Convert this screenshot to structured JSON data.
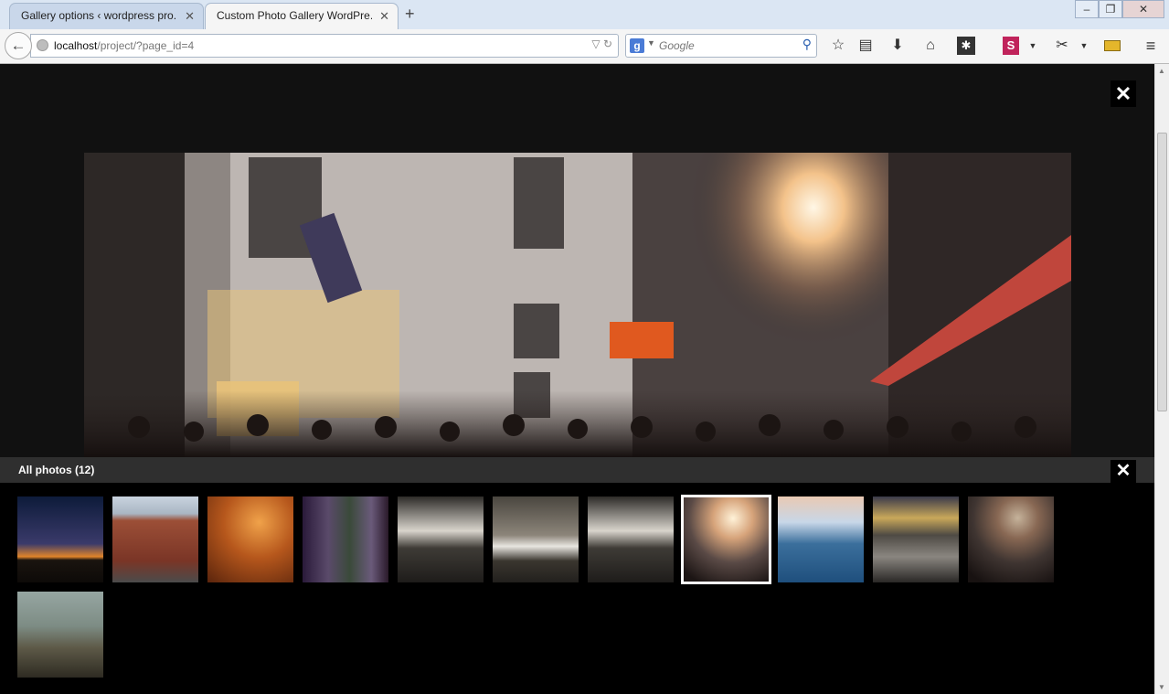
{
  "browser": {
    "tabs": [
      {
        "title": "Gallery options ‹ wordpress pro...",
        "active": false,
        "close": "✕"
      },
      {
        "title": "Custom Photo Gallery WordPre...",
        "active": true,
        "close": "✕"
      }
    ],
    "new_tab": "+",
    "window_controls": {
      "minimize": "‒",
      "restore": "❐",
      "close": "✕"
    },
    "back": "←",
    "url": {
      "host": "localhost",
      "path": "/project/?page_id=4"
    },
    "url_icons": "▽ ↻",
    "search": {
      "engine_icon": "g",
      "placeholder": "Google",
      "go": "⚲"
    },
    "toolbar_icons": [
      "star-icon",
      "reading-list-icon",
      "download-icon",
      "home-icon",
      "addon-icon",
      "s-extension-icon",
      "puzzle-icon",
      "screenshot-icon",
      "menu-icon"
    ],
    "s_extension_label": "S"
  },
  "lightbox": {
    "close": "✕",
    "main_photo": "street-crowd-sunset-photo",
    "strip": {
      "title": "All photos (12)",
      "close": "✕"
    },
    "thumbs": [
      {
        "name": "thumb-silhouette-dusk",
        "selected": false
      },
      {
        "name": "thumb-red-brick-corner",
        "selected": false
      },
      {
        "name": "thumb-autumn-bench",
        "selected": false
      },
      {
        "name": "thumb-forest-path",
        "selected": false
      },
      {
        "name": "thumb-waterfall-rocks",
        "selected": false
      },
      {
        "name": "thumb-desk-laptop",
        "selected": false
      },
      {
        "name": "thumb-waterfall-rocks-2",
        "selected": false
      },
      {
        "name": "thumb-street-sunset",
        "selected": true
      },
      {
        "name": "thumb-sea-cliff",
        "selected": false
      },
      {
        "name": "thumb-rocky-shore",
        "selected": false
      },
      {
        "name": "thumb-street-sunset-2",
        "selected": false
      },
      {
        "name": "thumb-mountain-haze",
        "selected": false
      }
    ]
  },
  "colors": {
    "page_bg": "#111111",
    "strip_bg": "#000000",
    "strip_head": "#2f2f2f",
    "chrome_bg": "#dbe6f3"
  }
}
